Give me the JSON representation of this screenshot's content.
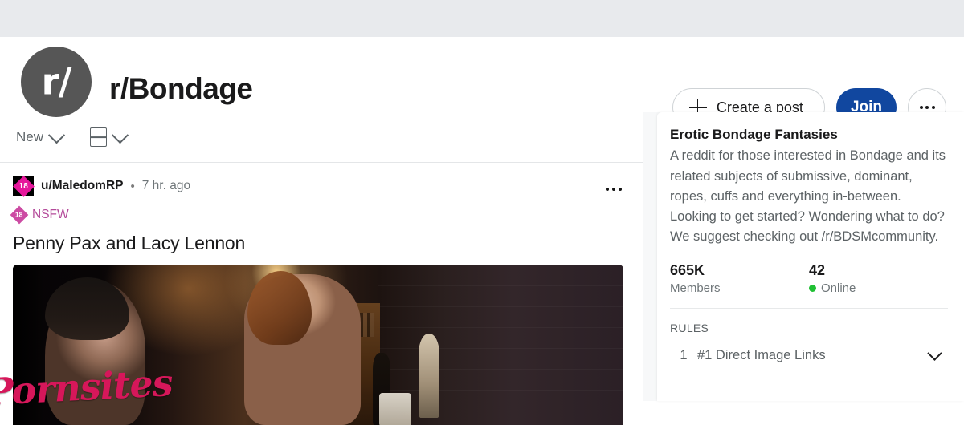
{
  "community": {
    "avatar_text": "r/",
    "title": "r/Bondage",
    "actions": {
      "create_post_label": "Create a post",
      "join_label": "Join",
      "more_label": "More options"
    },
    "colors": {
      "banner": "#e8eaed",
      "avatar": "#565656",
      "join_button": "#11479f",
      "online_green": "#20c034",
      "nsfw_pink": "#cc4ba3",
      "badge_magenta": "#e6179c",
      "watermark": "#d6175a"
    }
  },
  "sortbar": {
    "sort_label": "New",
    "sort_chevron": "chevron-down-icon",
    "view_icon": "card-view-icon",
    "view_chevron": "chevron-down-icon"
  },
  "post": {
    "author_badge": "18",
    "author": "u/MaledomRP",
    "separator": "•",
    "time": "7 hr. ago",
    "menu": "overflow-menu-icon",
    "nsfw_badge": "18",
    "nsfw_label": "NSFW",
    "title": "Penny Pax and Lacy Lennon",
    "media_watermark": "Pornsites"
  },
  "sidebar": {
    "title": "Erotic Bondage Fantasies",
    "description": "A reddit for those interested in Bondage and its related subjects of submissive, dominant, ropes, cuffs and everything in-between. Looking to get started? Wondering what to do? We suggest checking out /r/BDSMcommunity.",
    "stats": [
      {
        "value": "665K",
        "label": "Members"
      },
      {
        "value": "42",
        "label": "Online"
      }
    ],
    "rules_heading": "RULES",
    "rules": [
      {
        "number": "1",
        "text": "#1 Direct Image Links"
      }
    ]
  }
}
